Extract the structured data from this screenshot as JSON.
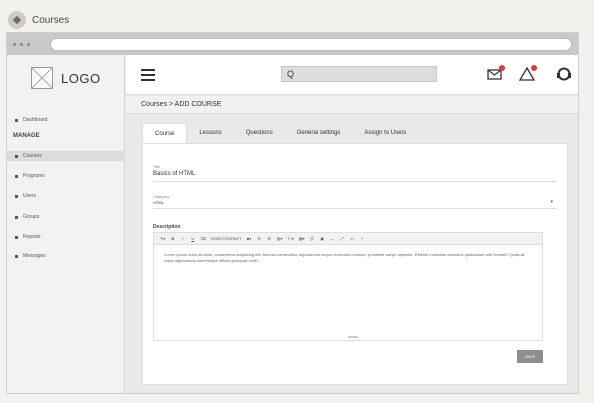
{
  "caption": {
    "title": "Courses"
  },
  "sidebar": {
    "logo_text": "LOGO",
    "dashboard": "Dashboard",
    "manage_label": "MANAGE",
    "items": [
      {
        "label": "Courses",
        "active": true
      },
      {
        "label": "Programs"
      },
      {
        "label": "Users"
      },
      {
        "label": "Groups"
      },
      {
        "label": "Reports"
      },
      {
        "label": "Messages"
      }
    ]
  },
  "header": {
    "search_icon": "Q"
  },
  "breadcrumb": "Courses > ADD COURSE",
  "tabs": [
    {
      "label": "Course",
      "active": true
    },
    {
      "label": "Lessons"
    },
    {
      "label": "Questions"
    },
    {
      "label": "General settings"
    },
    {
      "label": "Assign to Users"
    }
  ],
  "form": {
    "title_label": "Title",
    "title_value": "Basics of HTML",
    "category_label": "Category",
    "category_value": "HTML",
    "description_label": "Description",
    "toolbar_font": "ROBOTODRAFT",
    "body_text": "Lorem ipsum dolor sit amet, consectetur adipiscing elit. Aenean consectetur dignissimos neque reiciendis nostrum, provident saepe sapiente. Deleniti molestias doloribus quibusdam velit veniam? Quaerat nobis dignissimos doloremque officiis quisquam velit!",
    "save_label": "SAVE"
  },
  "colors": {
    "notification_badge": "#e23b3b",
    "sidebar_active": "#dcdcdc"
  }
}
